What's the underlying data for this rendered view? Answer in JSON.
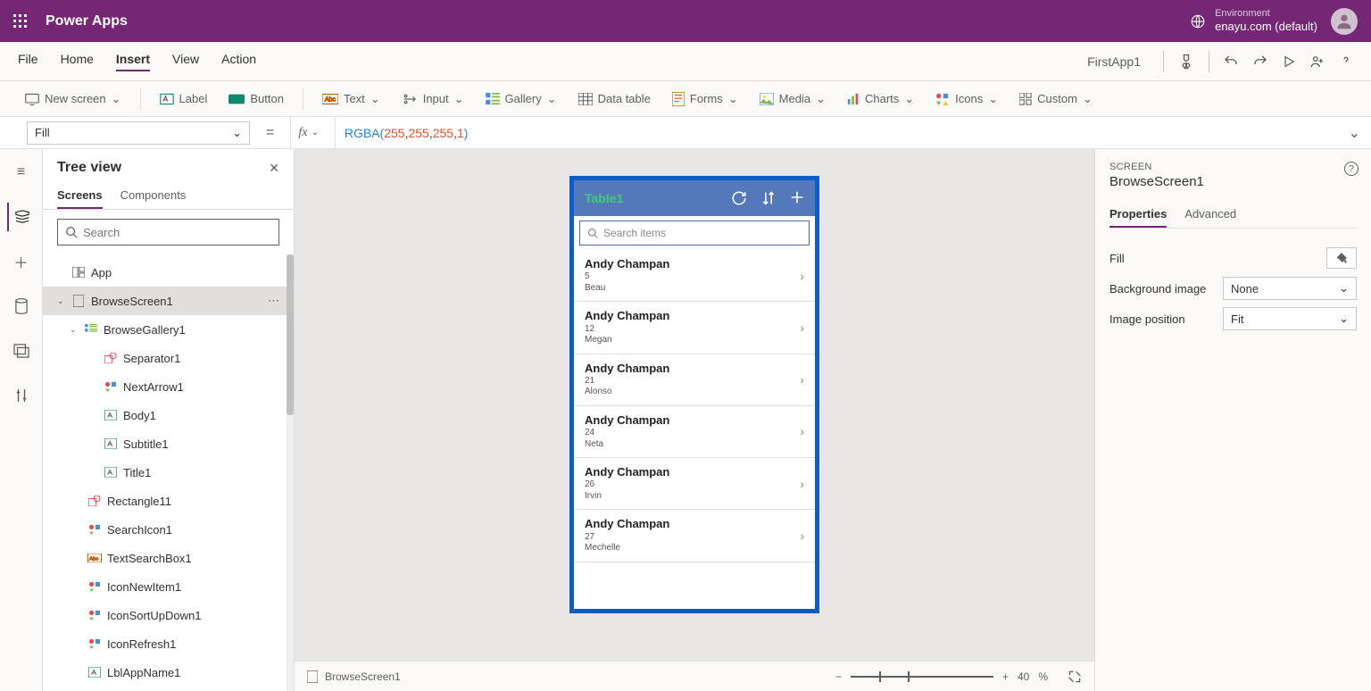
{
  "header": {
    "app_title": "Power Apps",
    "env_label": "Environment",
    "env_name": "enayu.com (default)"
  },
  "menu": {
    "items": [
      "File",
      "Home",
      "Insert",
      "View",
      "Action"
    ],
    "active": "Insert",
    "app_name": "FirstApp1"
  },
  "ribbon": {
    "new_screen": "New screen",
    "label": "Label",
    "button": "Button",
    "text": "Text",
    "input": "Input",
    "gallery": "Gallery",
    "data_table": "Data table",
    "forms": "Forms",
    "media": "Media",
    "charts": "Charts",
    "icons": "Icons",
    "custom": "Custom"
  },
  "formula": {
    "property": "Fill",
    "fn": "RGBA",
    "args": [
      "255",
      "255",
      "255",
      "1"
    ]
  },
  "tree": {
    "title": "Tree view",
    "tabs": {
      "screens": "Screens",
      "components": "Components"
    },
    "search_placeholder": "Search",
    "items": {
      "app": "App",
      "browse_screen": "BrowseScreen1",
      "browse_gallery": "BrowseGallery1",
      "separator": "Separator1",
      "next_arrow": "NextArrow1",
      "body": "Body1",
      "subtitle": "Subtitle1",
      "title": "Title1",
      "rectangle": "Rectangle11",
      "search_icon": "SearchIcon1",
      "text_search": "TextSearchBox1",
      "icon_new": "IconNewItem1",
      "icon_sort": "IconSortUpDown1",
      "icon_refresh": "IconRefresh1",
      "lbl_app": "LblAppName1"
    }
  },
  "canvas": {
    "phone_title": "Table1",
    "search_placeholder": "Search items",
    "rows": [
      {
        "title": "Andy Champan",
        "sub": "5",
        "body": "Beau"
      },
      {
        "title": "Andy Champan",
        "sub": "12",
        "body": "Megan"
      },
      {
        "title": "Andy Champan",
        "sub": "21",
        "body": "Alonso"
      },
      {
        "title": "Andy Champan",
        "sub": "24",
        "body": "Neta"
      },
      {
        "title": "Andy Champan",
        "sub": "26",
        "body": "Irvin"
      },
      {
        "title": "Andy Champan",
        "sub": "27",
        "body": "Mechelle"
      }
    ],
    "footer_screen": "BrowseScreen1",
    "zoom_value": "40",
    "zoom_pct": "%"
  },
  "props": {
    "section": "SCREEN",
    "name": "BrowseScreen1",
    "tabs": {
      "properties": "Properties",
      "advanced": "Advanced"
    },
    "fill_label": "Fill",
    "bg_image_label": "Background image",
    "bg_image_value": "None",
    "img_pos_label": "Image position",
    "img_pos_value": "Fit"
  }
}
